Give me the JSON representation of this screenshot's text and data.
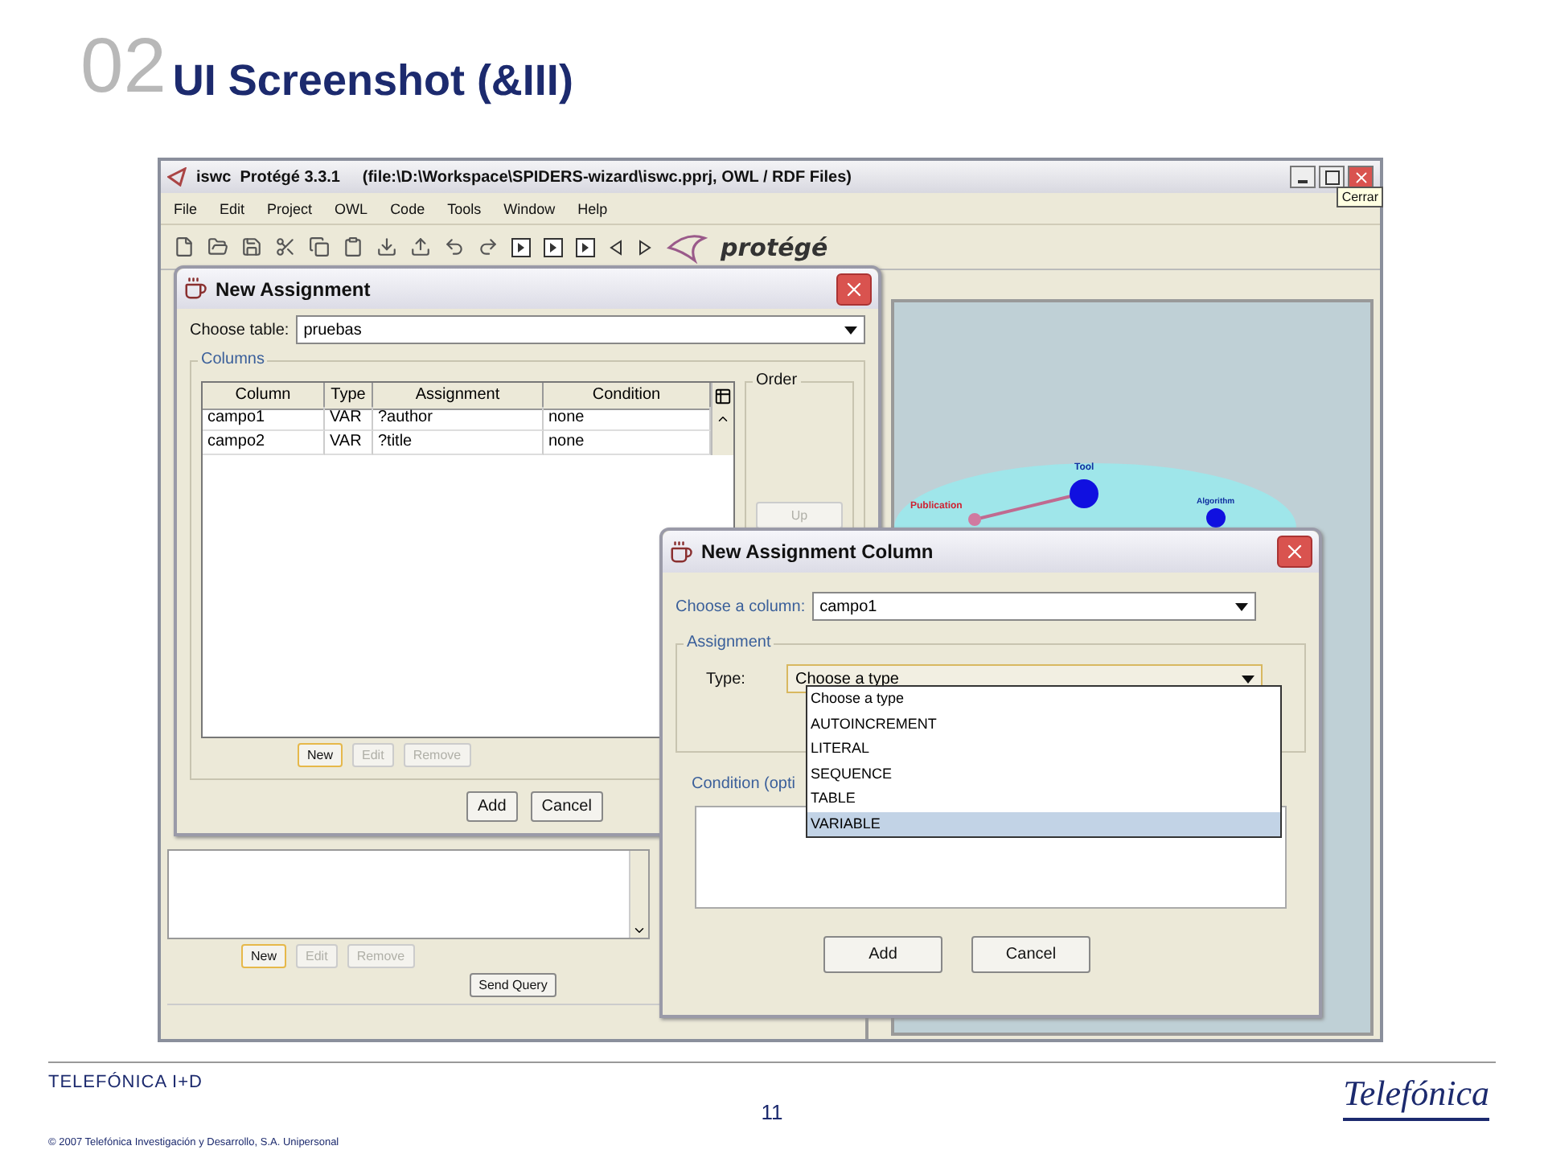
{
  "slide": {
    "number": "02",
    "title": "UI Screenshot (&III)"
  },
  "app_window": {
    "title": "iswc  Protégé 3.3.1     (file:\\D:\\Workspace\\SPIDERS-wizard\\iswc.pprj, OWL / RDF Files)",
    "close_tooltip": "Cerrar",
    "logo": "protégé",
    "menu": [
      "File",
      "Edit",
      "Project",
      "OWL",
      "Code",
      "Tools",
      "Window",
      "Help"
    ]
  },
  "graph": {
    "labels": [
      "Tool",
      "Publication",
      "Algorithm"
    ]
  },
  "query_panel": {
    "buttons": [
      {
        "label": "New",
        "disabled": false
      },
      {
        "label": "Edit",
        "disabled": true
      },
      {
        "label": "Remove",
        "disabled": true
      }
    ],
    "send": "Send Query"
  },
  "dialog_assignment": {
    "title": "New Assignment",
    "table_label": "Choose table:",
    "table_value": "pruebas",
    "group": "Columns",
    "columns": [
      "Column",
      "Type",
      "Assignment",
      "Condition"
    ],
    "rows": [
      [
        "campo1",
        "VAR",
        "?author",
        "none"
      ],
      [
        "campo2",
        "VAR",
        "?title",
        "none"
      ]
    ],
    "order": {
      "label": "Order",
      "up": "Up"
    },
    "buttons": [
      {
        "label": "New",
        "disabled": false
      },
      {
        "label": "Edit",
        "disabled": true
      },
      {
        "label": "Remove",
        "disabled": true
      }
    ],
    "actions": [
      "Add",
      "Cancel"
    ]
  },
  "dialog_column": {
    "title": "New Assignment Column",
    "column_label": "Choose a column:",
    "column_value": "campo1",
    "group": "Assignment",
    "type_label": "Type:",
    "type_value": "Choose a type",
    "options": [
      {
        "label": "Choose a type",
        "selected": false
      },
      {
        "label": "AUTOINCREMENT",
        "selected": false
      },
      {
        "label": "LITERAL",
        "selected": false
      },
      {
        "label": "SEQUENCE",
        "selected": false
      },
      {
        "label": "TABLE",
        "selected": false
      },
      {
        "label": "VARIABLE",
        "selected": true
      }
    ],
    "condition_label": "Condition (opti",
    "actions": [
      "Add",
      "Cancel"
    ]
  },
  "footer": {
    "company": "TELEFÓNICA I+D",
    "page": "11",
    "copyright": "© 2007 Telefónica Investigación y Desarrollo, S.A. Unipersonal",
    "logo": "Telefónica"
  }
}
